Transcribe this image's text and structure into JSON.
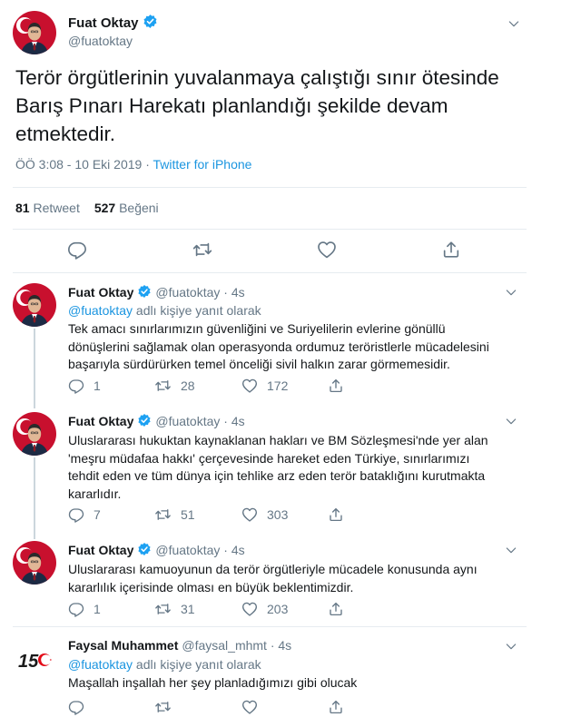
{
  "main": {
    "author_name": "Fuat Oktay",
    "author_handle": "@fuatoktay",
    "text": "Terör örgütlerinin yuvalanmaya çalıştığı sınır ötesinde Barış Pınarı Harekatı planlandığı şekilde devam etmektedir.",
    "timestamp": "ÖÖ 3:08 - 10 Eki 2019 · ",
    "source": "Twitter for iPhone",
    "retweet_count": "81",
    "retweet_label": "Retweet",
    "like_count": "527",
    "like_label": "Beğeni"
  },
  "replies": [
    {
      "name": "Fuat Oktay",
      "handle": "@fuatoktay · 4s",
      "replying_to": "@fuatoktay",
      "replying_suffix": " adlı kişiye yanıt olarak",
      "text": "Tek amacı sınırlarımızın güvenliğini ve Suriyelilerin evlerine gönüllü dönüşlerini sağlamak olan operasyonda ordumuz teröristlerle mücadelesini başarıyla sürdürürken temel önceliği sivil halkın zarar görmemesidir.",
      "replies": "1",
      "retweets": "28",
      "likes": "172"
    },
    {
      "name": "Fuat Oktay",
      "handle": "@fuatoktay · 4s",
      "text": "Uluslararası hukuktan kaynaklanan hakları ve BM Sözleşmesi'nde yer alan 'meşru müdafaa hakkı' çerçevesinde hareket eden Türkiye, sınırlarımızı tehdit eden ve tüm dünya için tehlike arz eden terör bataklığını kurutmakta kararlıdır.",
      "replies": "7",
      "retweets": "51",
      "likes": "303"
    },
    {
      "name": "Fuat Oktay",
      "handle": "@fuatoktay · 4s",
      "text": "Uluslararası kamuoyunun da terör örgütleriyle mücadele konusunda aynı kararlılık içerisinde olması en büyük beklentimizdir.",
      "replies": "1",
      "retweets": "31",
      "likes": "203"
    },
    {
      "name": "Faysal Muhammet",
      "handle": "@faysal_mhmt · 4s",
      "replying_to": "@fuatoktay",
      "replying_suffix": " adlı kişiye yanıt olarak",
      "text": "Maşallah inşallah her şey planladığımızı gibi olucak",
      "avatar_text": "15",
      "replies": "",
      "retweets": "",
      "likes": ""
    }
  ],
  "colors": {
    "accent": "#1b95e0",
    "verified": "#1da1f2",
    "muted": "#657786",
    "flag_red": "#e30a17"
  },
  "icons": [
    "verified-badge-icon",
    "chevron-down-icon",
    "reply-icon",
    "retweet-icon",
    "like-icon",
    "share-icon"
  ]
}
